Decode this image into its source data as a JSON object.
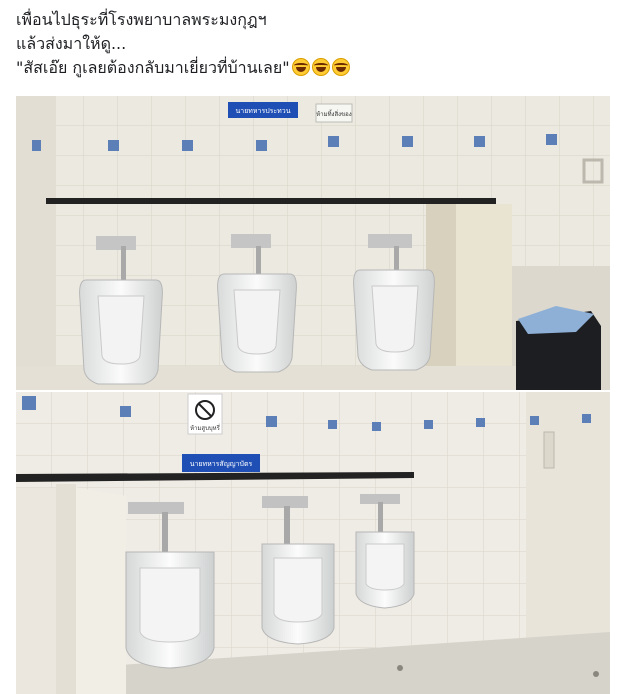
{
  "post": {
    "caption_line1": "เพื่อนไปธุระที่โรงพยาบาลพระมงกุฎฯ",
    "caption_line2": "แล้วส่งมาให้ดู...",
    "caption_line3": "\"สัสเอ๊ย กูเลยต้องกลับมาเยี่ยวที่บ้านเลย\"",
    "emoji_name": "grinning-face-with-sweat"
  },
  "photo_top": {
    "sign_text": "นายทหารประทวน",
    "paper_text": "ห้ามทิ้งสิ่งของ"
  },
  "photo_bottom": {
    "sign_text": "นายทหารสัญญาบัตร",
    "no_smoking_text": "ห้ามสูบบุหรี่"
  },
  "colors": {
    "tile": "#ece9e1",
    "tile_line": "#d6d2c8",
    "sign_blue": "#1f4fb5"
  }
}
